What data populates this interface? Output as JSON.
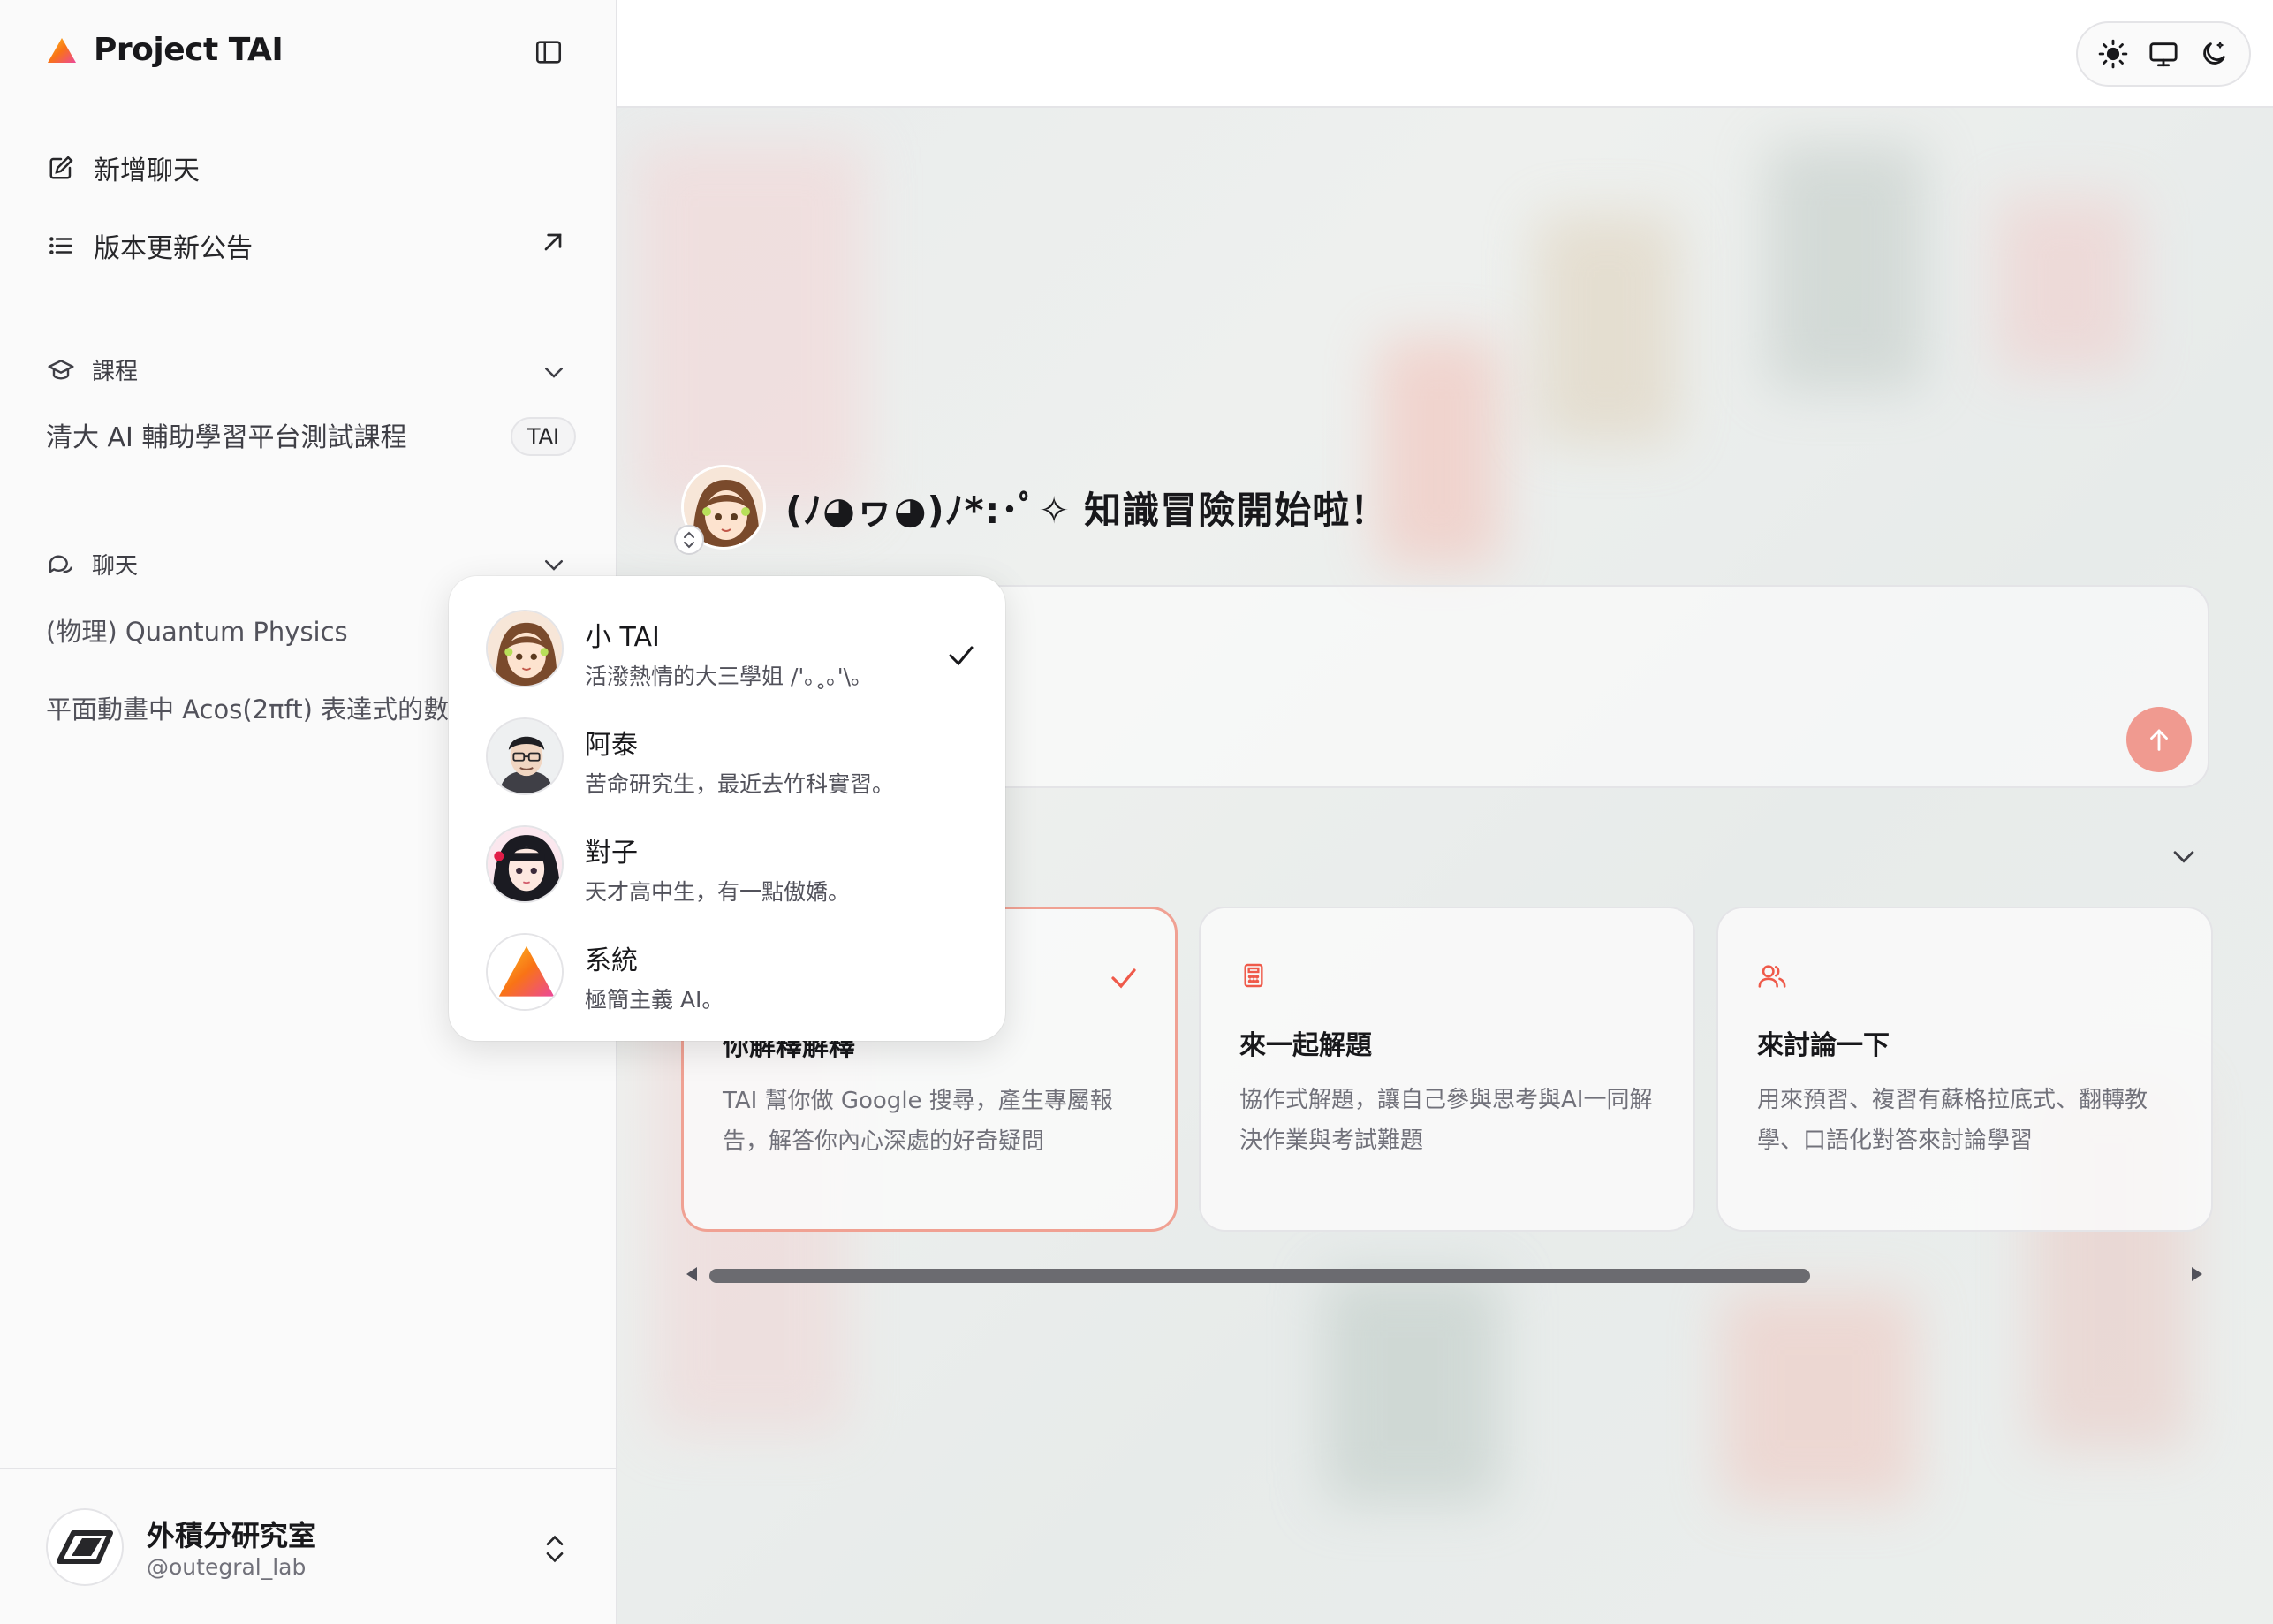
{
  "app": {
    "name": "Project TAI"
  },
  "nav": {
    "new_chat": "新增聊天",
    "changelog": "版本更新公告"
  },
  "courses": {
    "heading": "課程",
    "items": [
      {
        "label": "清大 AI 輔助學習平台測試課程",
        "badge": "TAI"
      }
    ]
  },
  "chats": {
    "heading": "聊天",
    "items": [
      {
        "label": "(物理) Quantum Physics"
      },
      {
        "label": "平面動畫中 Acos(2πft) 表達式的數"
      }
    ]
  },
  "user": {
    "name": "外積分研究室",
    "handle": "@outegral_lab"
  },
  "theme": {
    "options": [
      "light",
      "system",
      "dark"
    ],
    "selected": "light"
  },
  "hero": {
    "title": "(ﾉ◕ヮ◕)ﾉ*:･ﾟ✧ 知識冒險開始啦！"
  },
  "composer": {
    "placeholder": ""
  },
  "modes": [
    {
      "title": "你解釋解釋",
      "desc": "TAI 幫你做 Google 搜尋，產生專屬報告，解答你內心深處的好奇疑問",
      "icon": "search-icon",
      "selected": true
    },
    {
      "title": "來一起解題",
      "desc": "協作式解題，讓自己參與思考與AI一同解決作業與考試難題",
      "icon": "calculator-icon",
      "selected": false
    },
    {
      "title": "來討論一下",
      "desc": "用來預習、複習有蘇格拉底式、翻轉教學、口語化對答來討論學習",
      "icon": "users-icon",
      "selected": false
    }
  ],
  "personas": [
    {
      "name": "小 TAI",
      "desc": "活潑熱情的大三學姐 /'｡˳｡'\\｡",
      "selected": true
    },
    {
      "name": "阿泰",
      "desc": "苦命研究生，最近去竹科實習。",
      "selected": false
    },
    {
      "name": "對子",
      "desc": "天才高中生，有一點傲嬌。",
      "selected": false
    },
    {
      "name": "系統",
      "desc": "極簡主義 AI。",
      "selected": false
    }
  ],
  "colors": {
    "accent": "#ef5a4a",
    "send": "#f09a90",
    "card_active_border": "#f0a193"
  }
}
